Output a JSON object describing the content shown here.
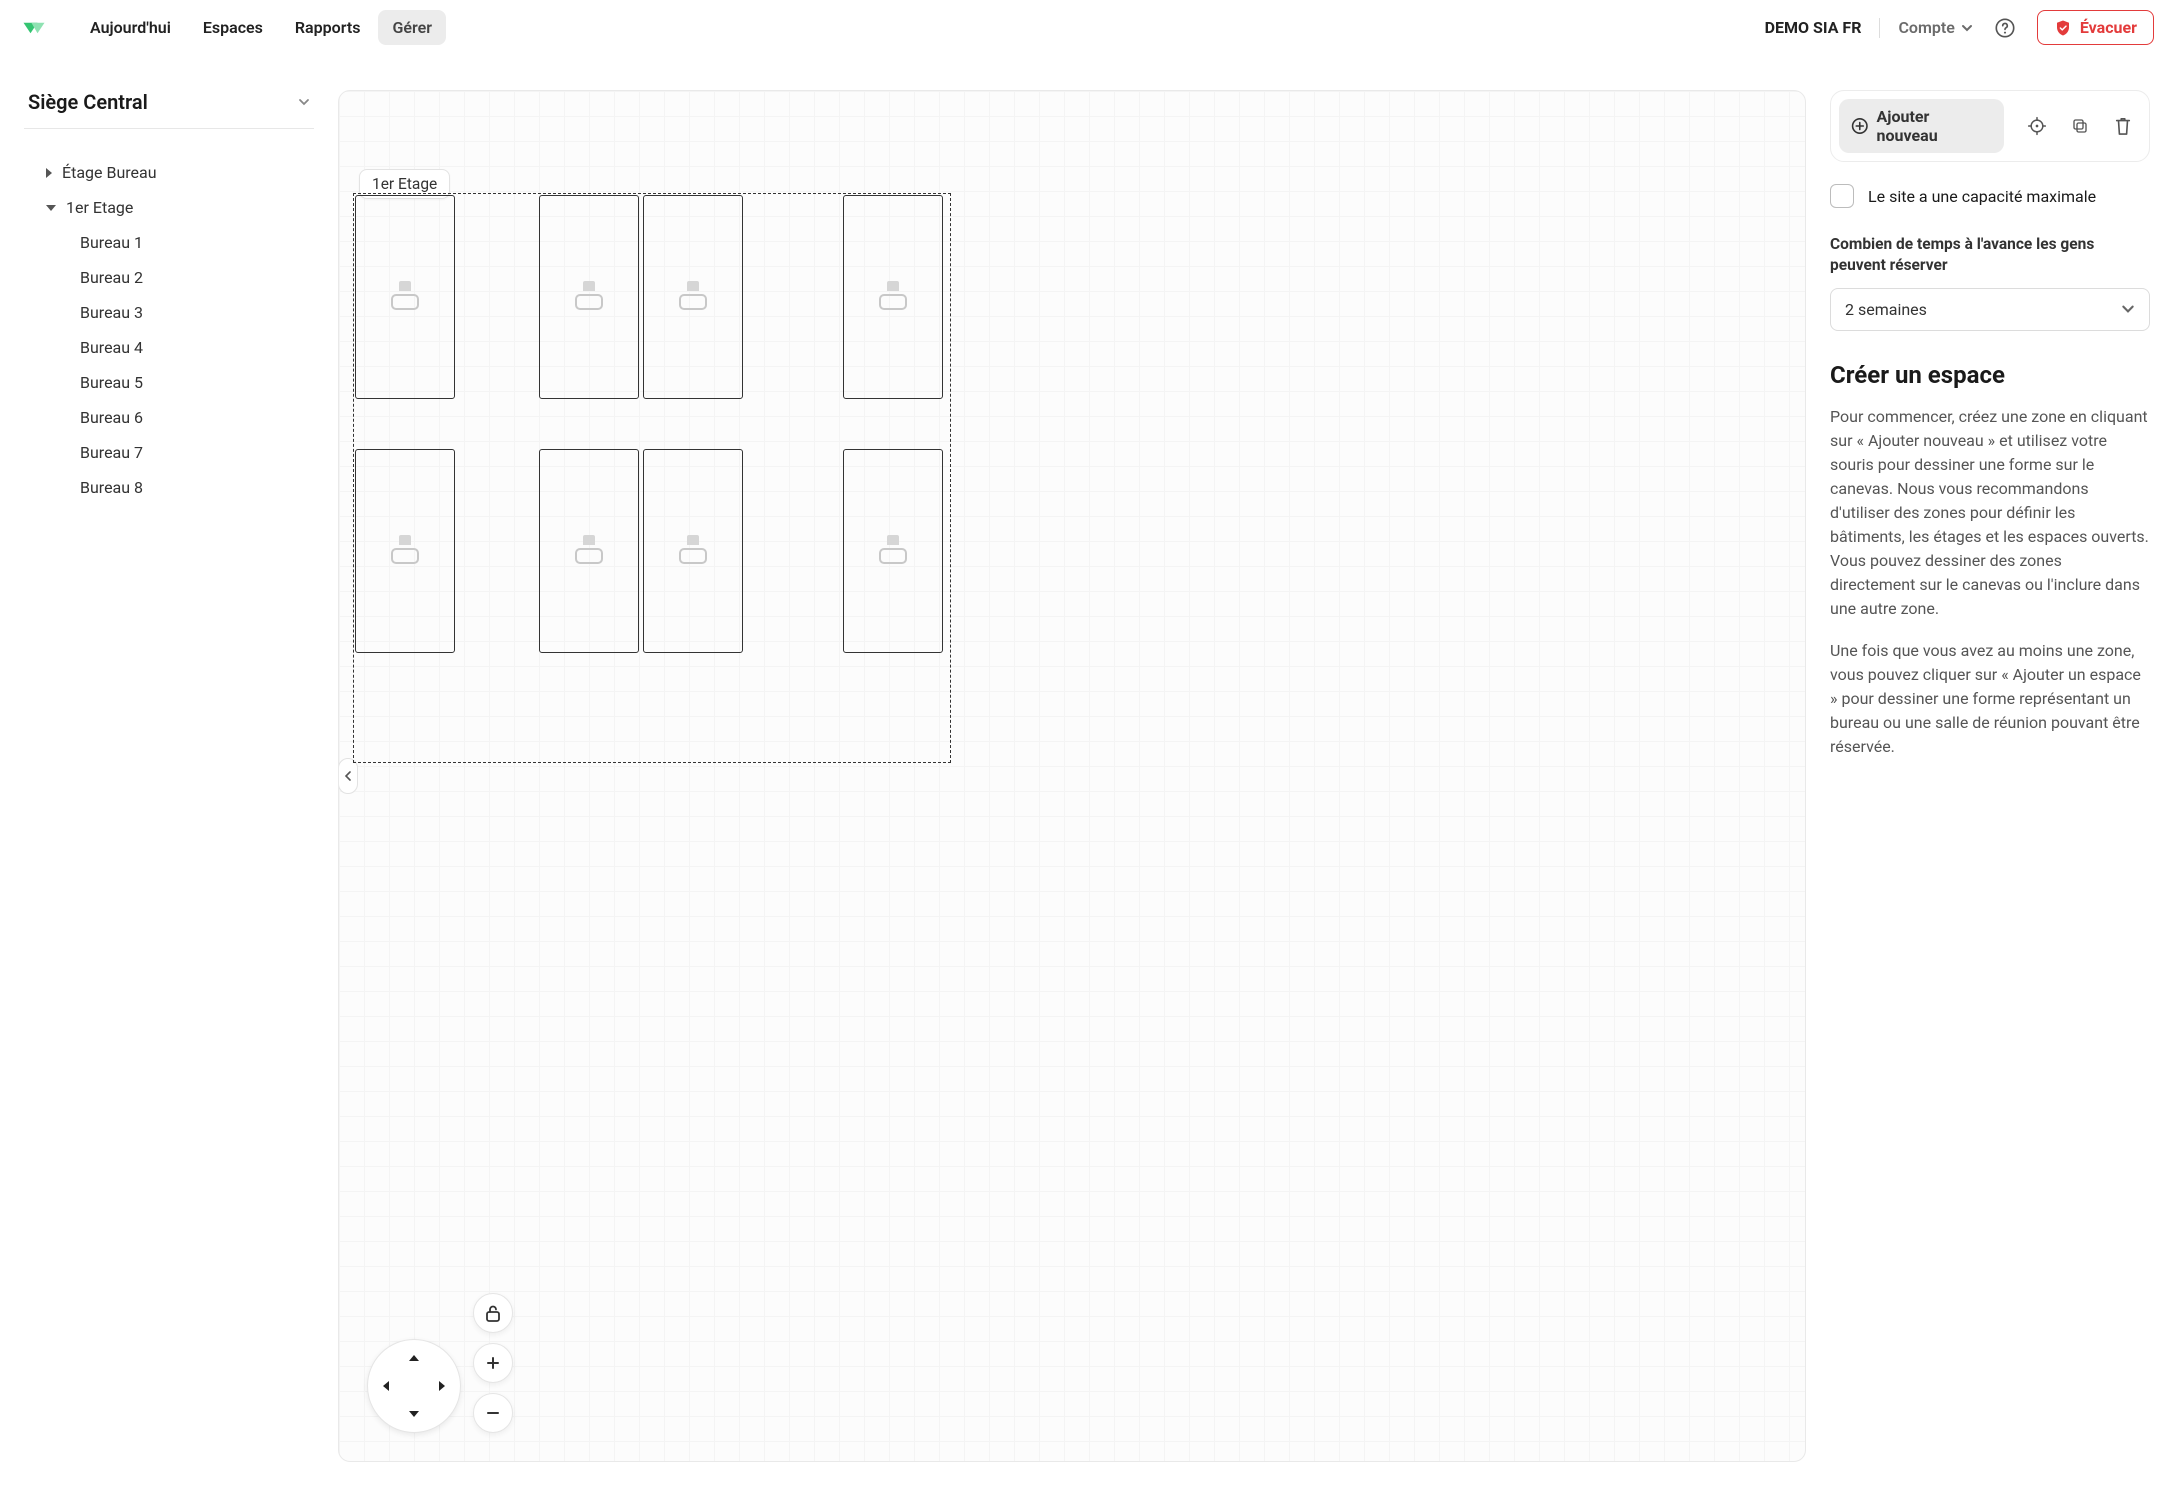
{
  "nav": {
    "today": "Aujourd'hui",
    "spaces": "Espaces",
    "reports": "Rapports",
    "manage": "Gérer"
  },
  "top": {
    "org": "DEMO SIA FR",
    "account": "Compte",
    "evacuate": "Évacuer"
  },
  "sidebar": {
    "site": "Siège Central",
    "floor_office": "Étage Bureau",
    "floor_1": "1er Etage",
    "desks": [
      "Bureau 1",
      "Bureau 2",
      "Bureau 3",
      "Bureau 4",
      "Bureau 5",
      "Bureau 6",
      "Bureau 7",
      "Bureau 8"
    ]
  },
  "canvas": {
    "floor_label": "1er Etage"
  },
  "panel": {
    "add_new": "Ajouter nouveau",
    "max_capacity_label": "Le site a une capacité maximale",
    "advance_label": "Combien de temps à l'avance les gens peuvent réserver",
    "advance_value": "2 semaines",
    "create_title": "Créer un espace",
    "create_p1": "Pour commencer, créez une zone en cliquant sur « Ajouter nouveau » et utilisez votre souris pour dessiner une forme sur le canevas. Nous vous recommandons d'utiliser des zones pour définir les bâtiments, les étages et les espaces ouverts. Vous pouvez dessiner des zones directement sur le canevas ou l'inclure dans une autre zone.",
    "create_p2": "Une fois que vous avez au moins une zone, vous pouvez cliquer sur « Ajouter un espace » pour dessiner une forme représentant un bureau ou une salle de réunion pouvant être réservée."
  }
}
